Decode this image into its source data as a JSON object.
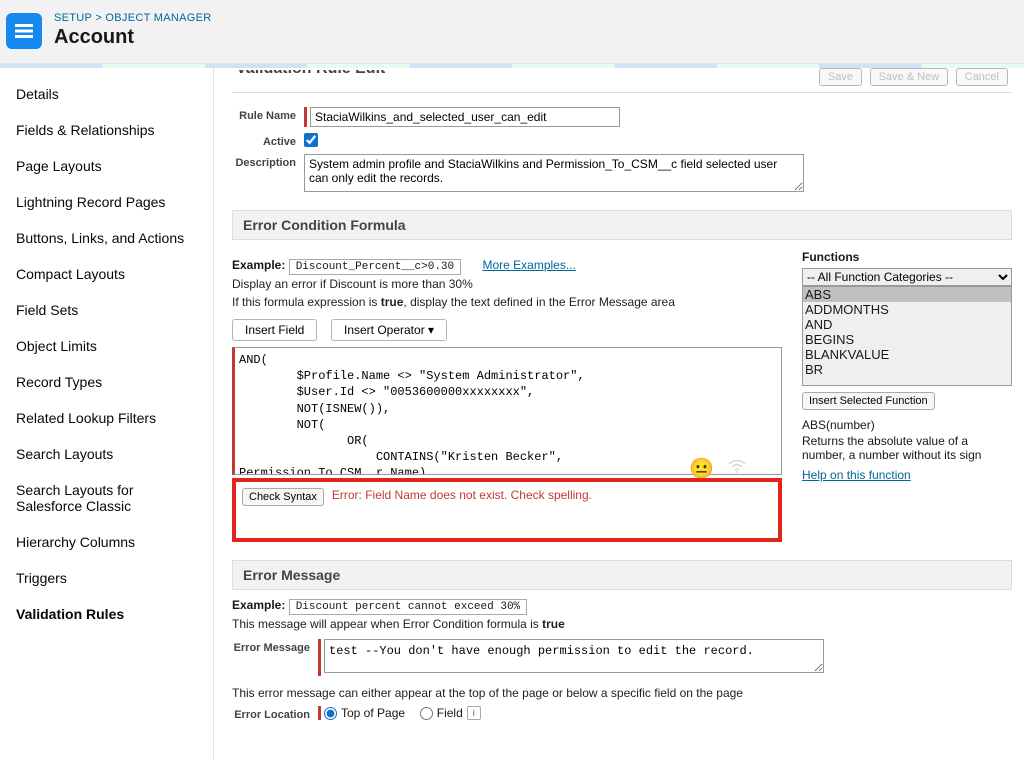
{
  "breadcrumb": {
    "setup": "SETUP",
    "sep": " > ",
    "obj_mgr": "OBJECT MANAGER"
  },
  "page_title": "Account",
  "sidebar": {
    "items": [
      "Details",
      "Fields & Relationships",
      "Page Layouts",
      "Lightning Record Pages",
      "Buttons, Links, and Actions",
      "Compact Layouts",
      "Field Sets",
      "Object Limits",
      "Record Types",
      "Related Lookup Filters",
      "Search Layouts",
      "Search Layouts for Salesforce Classic",
      "Hierarchy Columns",
      "Triggers",
      "Validation Rules"
    ],
    "active_index": 14
  },
  "toolbar": {
    "title_cut": "Validation Rule Edit",
    "save": "Save",
    "save_new": "Save & New",
    "cancel": "Cancel"
  },
  "rule": {
    "name_label": "Rule Name",
    "name_value": "StaciaWilkins_and_selected_user_can_edit",
    "active_label": "Active",
    "active": true,
    "desc_label": "Description",
    "desc_value": "System admin profile and StaciaWilkins and Permission_To_CSM__c field selected user can only edit the records."
  },
  "formula_section": "Error Condition Formula",
  "formula": {
    "example_label": "Example:",
    "example_code": "Discount_Percent__c>0.30",
    "more": "More Examples...",
    "hint1": "Display an error if Discount is more than 30%",
    "hint2_a": "If this formula expression is ",
    "hint2_b": "true",
    "hint2_c": ", display the text defined in the Error Message area",
    "insert_field": "Insert Field",
    "insert_op": "Insert Operator",
    "formula_text": "AND(\n        $Profile.Name <> \"System Administrator\",\n        $User.Id <> \"0053600000xxxxxxxx\",\n        NOT(ISNEW()),\n        NOT(\n               OR(\n                   CONTAINS(\"Kristen Becker\",\nPermission_To_CSM__r.Name),\n                   CONTAINS(\"Lisa Wilt\",\nPermission_To_CSM__r.Name)",
    "check_syntax": "Check Syntax",
    "error": "Error: Field Name does not exist. Check spelling."
  },
  "functions": {
    "title": "Functions",
    "all_cat": "-- All Function Categories --",
    "items": [
      "ABS",
      "ADDMONTHS",
      "AND",
      "BEGINS",
      "BLANKVALUE",
      "BR"
    ],
    "selected_index": 0,
    "insert_btn": "Insert Selected Function",
    "sig": "ABS(number)",
    "desc": "Returns the absolute value of a number, a number without its sign",
    "help": "Help on this function"
  },
  "msg_section": "Error Message",
  "error_msg": {
    "example_label": "Example:",
    "example_text": "Discount percent cannot exceed 30%",
    "hint_a": "This message will appear when Error Condition formula is ",
    "hint_b": "true",
    "label": "Error Message",
    "value": "test --You don't have enough permission to edit the record.",
    "loc_hint": "This error message can either appear at the top of the page or below a specific field on the page",
    "loc_label": "Error Location",
    "top": "Top of Page",
    "field": "Field"
  }
}
